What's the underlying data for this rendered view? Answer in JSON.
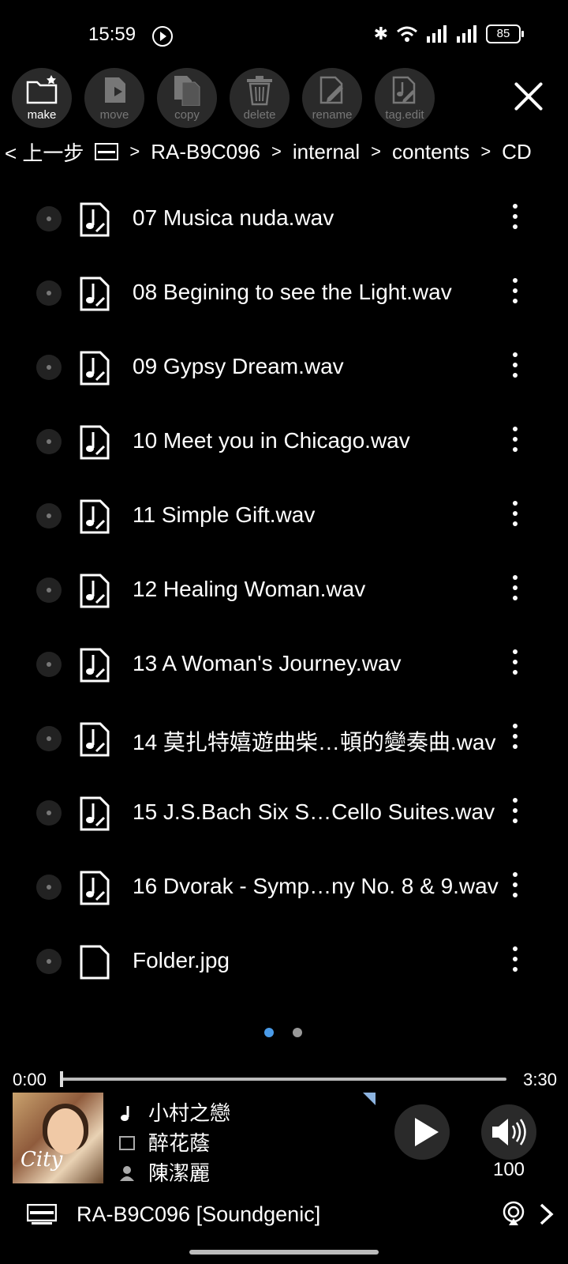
{
  "status_bar": {
    "time": "15:59",
    "battery": "85"
  },
  "toolbar": {
    "buttons": [
      {
        "label": "make",
        "icon": "new-folder-icon"
      },
      {
        "label": "move",
        "icon": "move-icon"
      },
      {
        "label": "copy",
        "icon": "copy-icon"
      },
      {
        "label": "delete",
        "icon": "trash-icon"
      },
      {
        "label": "rename",
        "icon": "rename-icon"
      },
      {
        "label": "tag.edit",
        "icon": "tag-edit-icon"
      }
    ]
  },
  "breadcrumb": {
    "back_label": "< 上一步",
    "items": [
      "RA-B9C096",
      "internal",
      "contents",
      "CD"
    ]
  },
  "files": [
    {
      "name": "07 Musica nuda.wav",
      "type": "audio"
    },
    {
      "name": "08 Begining to see the Light.wav",
      "type": "audio"
    },
    {
      "name": "09 Gypsy Dream.wav",
      "type": "audio"
    },
    {
      "name": "10 Meet you in Chicago.wav",
      "type": "audio"
    },
    {
      "name": "11 Simple Gift.wav",
      "type": "audio"
    },
    {
      "name": "12 Healing Woman.wav",
      "type": "audio"
    },
    {
      "name": "13 A Woman's Journey.wav",
      "type": "audio"
    },
    {
      "name": "14 莫扎特嬉遊曲柴…頓的變奏曲.wav",
      "type": "audio"
    },
    {
      "name": "15 J.S.Bach Six S…Cello Suites.wav",
      "type": "audio"
    },
    {
      "name": "16 Dvorak - Symp…ny No. 8 & 9.wav",
      "type": "audio"
    },
    {
      "name": "Folder.jpg",
      "type": "image"
    }
  ],
  "pager": {
    "pages": 2,
    "current": 1
  },
  "player": {
    "elapsed": "0:00",
    "duration": "3:30",
    "progress": 0,
    "track": "小村之戀",
    "album": "醉花蔭",
    "artist": "陳潔麗",
    "cover_text": "City",
    "volume": "100"
  },
  "renderer": {
    "name": "RA-B9C096 [Soundgenic]"
  }
}
